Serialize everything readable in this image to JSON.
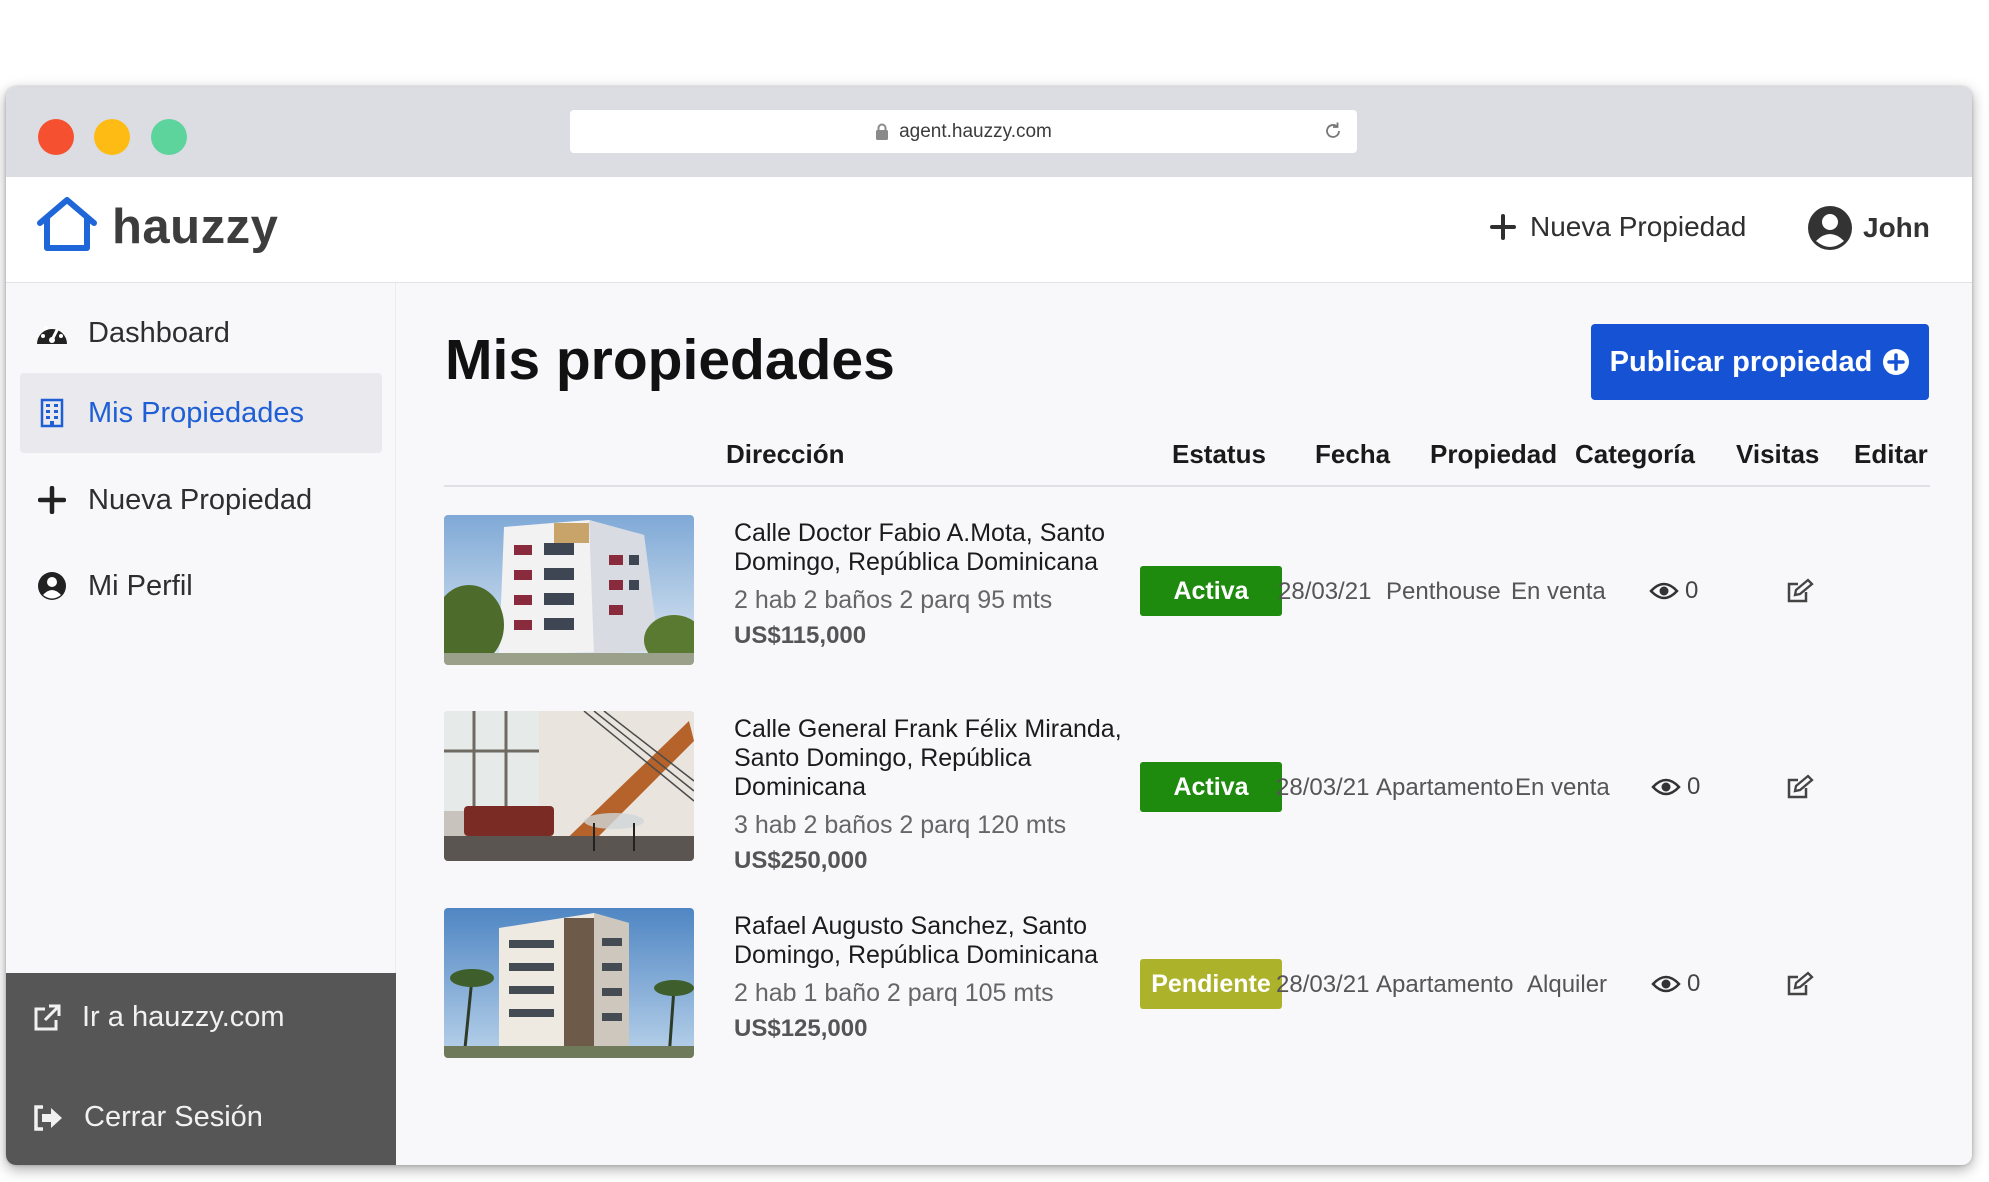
{
  "browser": {
    "url": "agent.hauzzy.com"
  },
  "header": {
    "brand": "hauzzy",
    "new_property": "Nueva Propiedad",
    "user": "John"
  },
  "sidebar": {
    "items": [
      {
        "label": "Dashboard",
        "icon": "gauge-icon"
      },
      {
        "label": "Mis Propiedades",
        "icon": "building-icon"
      },
      {
        "label": "Nueva Propiedad",
        "icon": "plus-icon"
      },
      {
        "label": "Mi Perfil",
        "icon": "user-circle-icon"
      }
    ],
    "bottom": [
      {
        "label": "Ir a hauzzy.com",
        "icon": "external-link-icon"
      },
      {
        "label": "Cerrar Sesión",
        "icon": "sign-out-icon"
      }
    ]
  },
  "main": {
    "title": "Mis propiedades",
    "publish_button": "Publicar propiedad",
    "columns": [
      "Dirección",
      "Estatus",
      "Fecha",
      "Propiedad",
      "Categoría",
      "Visitas",
      "Editar"
    ],
    "rows": [
      {
        "address": "Calle Doctor Fabio A.Mota, Santo Domingo, República Dominicana",
        "specs": "2 hab  2 baños  2 parq  95 mts",
        "price": "US$115,000",
        "status": "Activa",
        "date": "28/03/21",
        "property": "Penthouse",
        "category": "En venta",
        "visits": "0"
      },
      {
        "address": "Calle General Frank Félix Miranda, Santo Domingo, República Dominicana",
        "specs": "3 hab  2 baños  2 parq  120 mts",
        "price": "US$250,000",
        "status": "Activa",
        "date": "28/03/21",
        "property": "Apartamento",
        "category": "En venta",
        "visits": "0"
      },
      {
        "address": "Rafael Augusto Sanchez, Santo Domingo, República Dominicana",
        "specs": "2 hab  1 baño  2 parq  105 mts",
        "price": "US$125,000",
        "status": "Pendiente",
        "date": "28/03/21",
        "property": "Apartamento",
        "category": "Alquiler",
        "visits": "0"
      }
    ]
  },
  "colors": {
    "brand_blue": "#1653d4",
    "active_green": "#1e8a0e",
    "pending_olive": "#adb22b",
    "sidebar_bottom": "#565656"
  }
}
